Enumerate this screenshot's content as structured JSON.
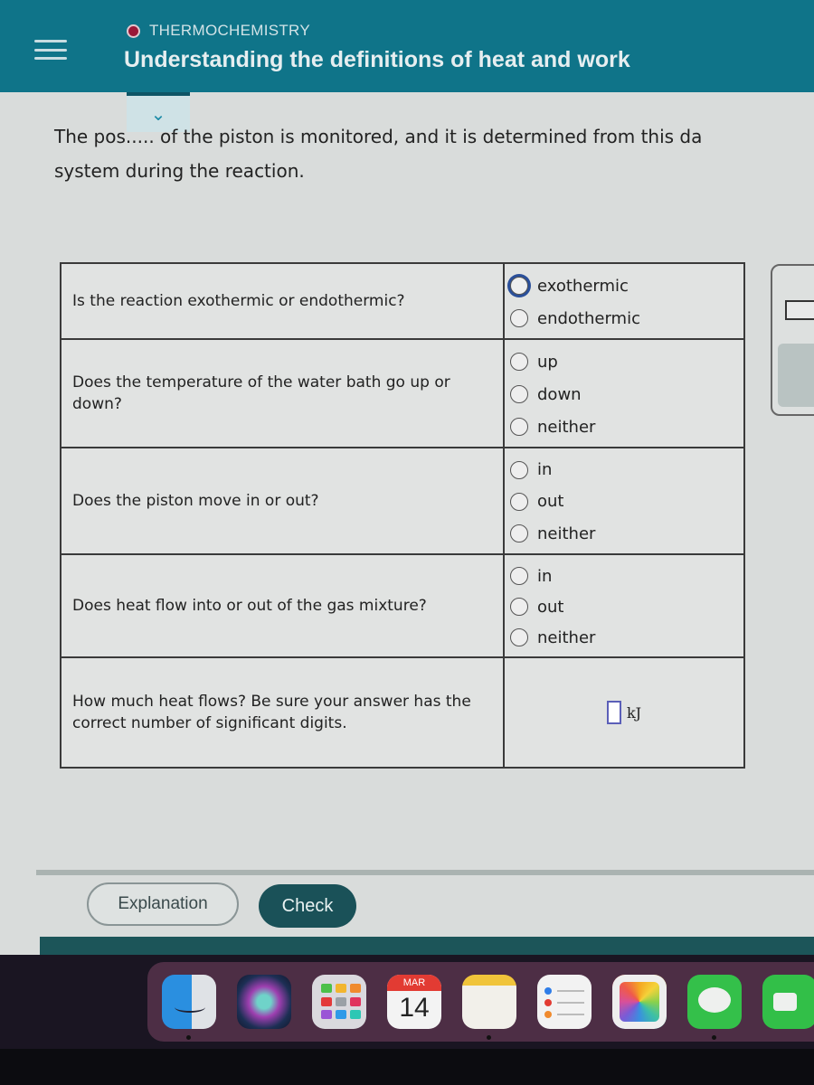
{
  "header": {
    "section": "THERMOCHEMISTRY",
    "title": "Understanding the definitions of heat and work",
    "section_dot_color": "#9a1838"
  },
  "collapse_icon": "chevron-down-icon",
  "intro": {
    "line1": "The pos..... of the piston is monitored, and it is determined from this da",
    "line2": "system during the reaction."
  },
  "questions": [
    {
      "prompt": "Is the reaction exothermic or endothermic?",
      "options": [
        "exothermic",
        "endothermic"
      ],
      "focused_option": 0
    },
    {
      "prompt": "Does the temperature of the water bath go up or down?",
      "options": [
        "up",
        "down",
        "neither"
      ]
    },
    {
      "prompt": "Does the piston move in or out?",
      "options": [
        "in",
        "out",
        "neither"
      ]
    },
    {
      "prompt": "Does heat flow into or out of the gas mixture?",
      "options": [
        "in",
        "out",
        "neither"
      ]
    },
    {
      "prompt": "How much heat flows? Be sure your answer has the correct number of significant digits.",
      "input_value": "",
      "unit": "kJ"
    }
  ],
  "buttons": {
    "explanation": "Explanation",
    "check": "Check"
  },
  "dock": {
    "apps": [
      "Finder",
      "Siri",
      "Launchpad",
      "Calendar",
      "Notes",
      "Reminders",
      "Photos",
      "Messages",
      "FaceTime"
    ],
    "calendar_month": "MAR",
    "calendar_day": "14"
  },
  "colors": {
    "header_bg": "#0f7489",
    "check_button_bg": "#1a5158",
    "input_border": "#5b5fb8",
    "focus_ring": "#2a4f9a"
  }
}
